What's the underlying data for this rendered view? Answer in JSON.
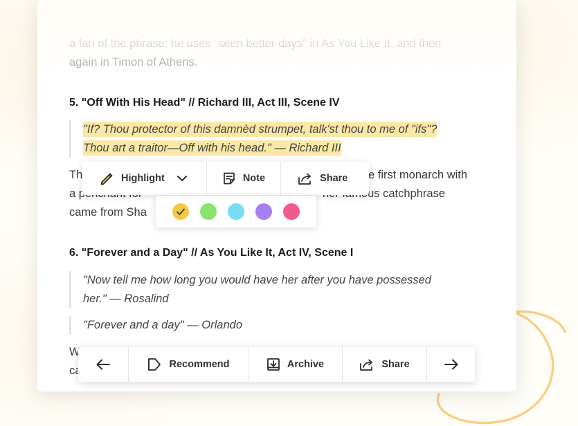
{
  "article": {
    "intro_line1": "a fan of the phrase; he uses \"seen better days\" in As You Like It, and then",
    "intro_line2": "again in Timon of Athens.",
    "section5": {
      "title_bold": "5. \"Off With His Head\" //",
      "title_rest": " Richard III, Act III, Scene IV",
      "quote_line1": "\"If? Thou protector of this damnèd strumpet, talk'st thou to me of \"ifs\"?",
      "quote_line2": "Thou art a traitor—Off with his head.\" — Richard III",
      "para_line1_start": "Th",
      "para_line1_end": "e first monarch with",
      "para_line2_start": "a penchant for",
      "para_line2_end": "her famous catchphrase",
      "para_line3_start": "came from Sha"
    },
    "section6": {
      "title_bold": "6. \"Forever and a Day\" //",
      "title_rest": " As You Like It, Act IV, Scene I",
      "quote1_line1": "\"Now tell me how long you would have her after you have possessed",
      "quote1_line2": "her.\" — Rosalind",
      "quote2": "\"Forever and a day\" — Orlando",
      "para_line1_start": "W",
      "para_line2_start": "ca"
    }
  },
  "highlight_toolbar": {
    "highlight_label": "Highlight",
    "note_label": "Note",
    "share_label": "Share",
    "swatches": [
      {
        "color": "#f6c944",
        "selected": true
      },
      {
        "color": "#86e46f",
        "selected": false
      },
      {
        "color": "#79dcf6",
        "selected": false
      },
      {
        "color": "#a97ff0",
        "selected": false
      },
      {
        "color": "#f2598e",
        "selected": false
      }
    ]
  },
  "bottom_toolbar": {
    "recommend_label": "Recommend",
    "archive_label": "Archive",
    "share_label": "Share"
  },
  "colors": {
    "highlight": "#fbe8a6",
    "swirl": "#f8cf86"
  },
  "icons": [
    "pencil-icon",
    "chevron-down-icon",
    "note-icon",
    "share-icon",
    "check-icon",
    "arrow-left-icon",
    "recommend-icon",
    "archive-icon",
    "arrow-right-icon"
  ]
}
